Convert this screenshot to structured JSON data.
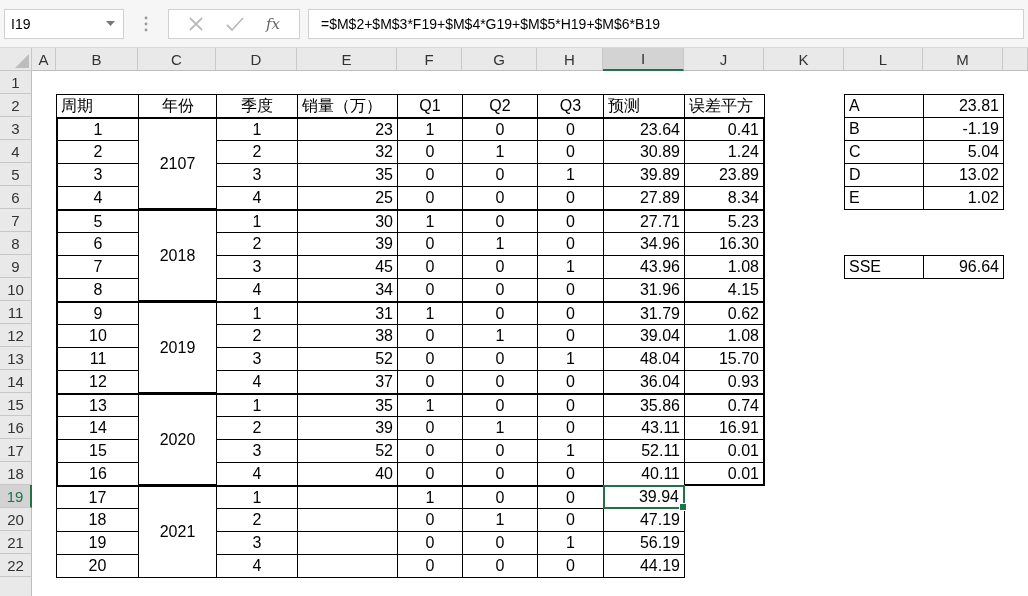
{
  "formula_bar": {
    "name_box": "I19",
    "function_label": "fx",
    "formula": "=$M$2+$M$3*F19+$M$4*G19+$M$5*H19+$M$6*B19"
  },
  "column_headers": [
    {
      "label": "A",
      "selected": false
    },
    {
      "label": "B",
      "selected": false
    },
    {
      "label": "C",
      "selected": false
    },
    {
      "label": "D",
      "selected": false
    },
    {
      "label": "E",
      "selected": false
    },
    {
      "label": "F",
      "selected": false
    },
    {
      "label": "G",
      "selected": false
    },
    {
      "label": "H",
      "selected": false
    },
    {
      "label": "I",
      "selected": true
    },
    {
      "label": "J",
      "selected": false
    },
    {
      "label": "K",
      "selected": false
    },
    {
      "label": "L",
      "selected": false
    },
    {
      "label": "M",
      "selected": false
    }
  ],
  "row_headers": [
    {
      "label": "1",
      "selected": false
    },
    {
      "label": "2",
      "selected": false
    },
    {
      "label": "3",
      "selected": false
    },
    {
      "label": "4",
      "selected": false
    },
    {
      "label": "5",
      "selected": false
    },
    {
      "label": "6",
      "selected": false
    },
    {
      "label": "7",
      "selected": false
    },
    {
      "label": "8",
      "selected": false
    },
    {
      "label": "9",
      "selected": false
    },
    {
      "label": "10",
      "selected": false
    },
    {
      "label": "11",
      "selected": false
    },
    {
      "label": "12",
      "selected": false
    },
    {
      "label": "13",
      "selected": false
    },
    {
      "label": "14",
      "selected": false
    },
    {
      "label": "15",
      "selected": false
    },
    {
      "label": "16",
      "selected": false
    },
    {
      "label": "17",
      "selected": false
    },
    {
      "label": "18",
      "selected": false
    },
    {
      "label": "19",
      "selected": true
    },
    {
      "label": "20",
      "selected": false
    },
    {
      "label": "21",
      "selected": false
    },
    {
      "label": "22",
      "selected": false
    }
  ],
  "table": {
    "columns": [
      "周期",
      "年份",
      "季度",
      "销量（万）",
      "Q1",
      "Q2",
      "Q3",
      "预测",
      "误差平方"
    ],
    "groups": [
      {
        "year": "2107",
        "rows": [
          {
            "period": "1",
            "quarter": "1",
            "sales": "23",
            "q1": "1",
            "q2": "0",
            "q3": "0",
            "forecast": "23.64",
            "error_sq": "0.41",
            "selected": false
          },
          {
            "period": "2",
            "quarter": "2",
            "sales": "32",
            "q1": "0",
            "q2": "1",
            "q3": "0",
            "forecast": "30.89",
            "error_sq": "1.24",
            "selected": false
          },
          {
            "period": "3",
            "quarter": "3",
            "sales": "35",
            "q1": "0",
            "q2": "0",
            "q3": "1",
            "forecast": "39.89",
            "error_sq": "23.89",
            "selected": false
          },
          {
            "period": "4",
            "quarter": "4",
            "sales": "25",
            "q1": "0",
            "q2": "0",
            "q3": "0",
            "forecast": "27.89",
            "error_sq": "8.34",
            "selected": false
          }
        ]
      },
      {
        "year": "2018",
        "rows": [
          {
            "period": "5",
            "quarter": "1",
            "sales": "30",
            "q1": "1",
            "q2": "0",
            "q3": "0",
            "forecast": "27.71",
            "error_sq": "5.23",
            "selected": false
          },
          {
            "period": "6",
            "quarter": "2",
            "sales": "39",
            "q1": "0",
            "q2": "1",
            "q3": "0",
            "forecast": "34.96",
            "error_sq": "16.30",
            "selected": false
          },
          {
            "period": "7",
            "quarter": "3",
            "sales": "45",
            "q1": "0",
            "q2": "0",
            "q3": "1",
            "forecast": "43.96",
            "error_sq": "1.08",
            "selected": false
          },
          {
            "period": "8",
            "quarter": "4",
            "sales": "34",
            "q1": "0",
            "q2": "0",
            "q3": "0",
            "forecast": "31.96",
            "error_sq": "4.15",
            "selected": false
          }
        ]
      },
      {
        "year": "2019",
        "rows": [
          {
            "period": "9",
            "quarter": "1",
            "sales": "31",
            "q1": "1",
            "q2": "0",
            "q3": "0",
            "forecast": "31.79",
            "error_sq": "0.62",
            "selected": false
          },
          {
            "period": "10",
            "quarter": "2",
            "sales": "38",
            "q1": "0",
            "q2": "1",
            "q3": "0",
            "forecast": "39.04",
            "error_sq": "1.08",
            "selected": false
          },
          {
            "period": "11",
            "quarter": "3",
            "sales": "52",
            "q1": "0",
            "q2": "0",
            "q3": "1",
            "forecast": "48.04",
            "error_sq": "15.70",
            "selected": false
          },
          {
            "period": "12",
            "quarter": "4",
            "sales": "37",
            "q1": "0",
            "q2": "0",
            "q3": "0",
            "forecast": "36.04",
            "error_sq": "0.93",
            "selected": false
          }
        ]
      },
      {
        "year": "2020",
        "rows": [
          {
            "period": "13",
            "quarter": "1",
            "sales": "35",
            "q1": "1",
            "q2": "0",
            "q3": "0",
            "forecast": "35.86",
            "error_sq": "0.74",
            "selected": false
          },
          {
            "period": "14",
            "quarter": "2",
            "sales": "39",
            "q1": "0",
            "q2": "1",
            "q3": "0",
            "forecast": "43.11",
            "error_sq": "16.91",
            "selected": false
          },
          {
            "period": "15",
            "quarter": "3",
            "sales": "52",
            "q1": "0",
            "q2": "0",
            "q3": "1",
            "forecast": "52.11",
            "error_sq": "0.01",
            "selected": false
          },
          {
            "period": "16",
            "quarter": "4",
            "sales": "40",
            "q1": "0",
            "q2": "0",
            "q3": "0",
            "forecast": "40.11",
            "error_sq": "0.01",
            "selected": false
          }
        ]
      },
      {
        "year": "2021",
        "rows": [
          {
            "period": "17",
            "quarter": "1",
            "q1": "1",
            "q2": "0",
            "q3": "0",
            "forecast": "39.94",
            "selected": true
          },
          {
            "period": "18",
            "quarter": "2",
            "q1": "0",
            "q2": "1",
            "q3": "0",
            "forecast": "47.19",
            "selected": false
          },
          {
            "period": "19",
            "quarter": "3",
            "q1": "0",
            "q2": "0",
            "q3": "1",
            "forecast": "56.19",
            "selected": false
          },
          {
            "period": "20",
            "quarter": "4",
            "q1": "0",
            "q2": "0",
            "q3": "0",
            "forecast": "44.19",
            "selected": false
          }
        ]
      }
    ]
  },
  "parameters": [
    {
      "label": "A",
      "value": "23.81"
    },
    {
      "label": "B",
      "value": "-1.19"
    },
    {
      "label": "C",
      "value": "5.04"
    },
    {
      "label": "D",
      "value": "13.02"
    },
    {
      "label": "E",
      "value": "1.02"
    }
  ],
  "sse": {
    "label": "SSE",
    "value": "96.64"
  }
}
